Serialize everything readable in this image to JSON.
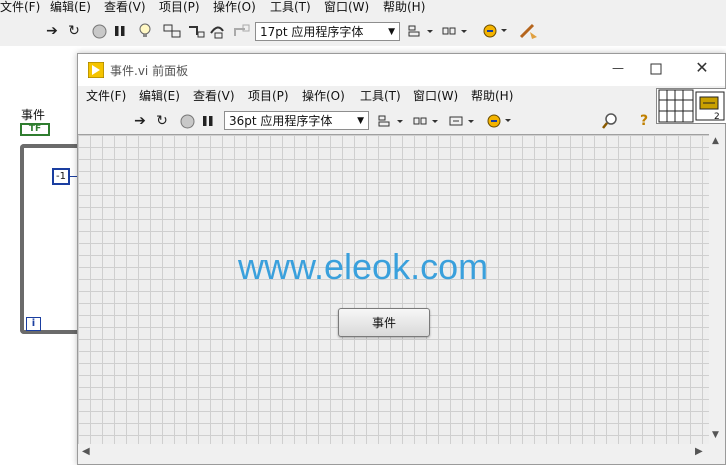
{
  "bd_menu": [
    "文件(F)",
    "编辑(E)",
    "查看(V)",
    "项目(P)",
    "操作(O)",
    "工具(T)",
    "窗口(W)",
    "帮助(H)"
  ],
  "bd_toolbar": {
    "font": "17pt 应用程序字体"
  },
  "block_diagram": {
    "event_label": "事件",
    "bool_terminal": "TF",
    "constant": "-1",
    "iteration": "i"
  },
  "front_panel": {
    "title": "事件.vi 前面板",
    "menu": [
      "文件(F)",
      "编辑(E)",
      "查看(V)",
      "项目(P)",
      "操作(O)",
      "工具(T)",
      "窗口(W)",
      "帮助(H)"
    ],
    "font": "36pt 应用程序字体",
    "watermark": "www.eleok.com",
    "button_label": "事件",
    "connector_badge": "2"
  },
  "colors": {
    "watermark": "#3aa0dc",
    "loop_border": "#6b6b6b",
    "terminal_blue": "#1a3ea0",
    "bool_green": "#2f7d2f"
  }
}
